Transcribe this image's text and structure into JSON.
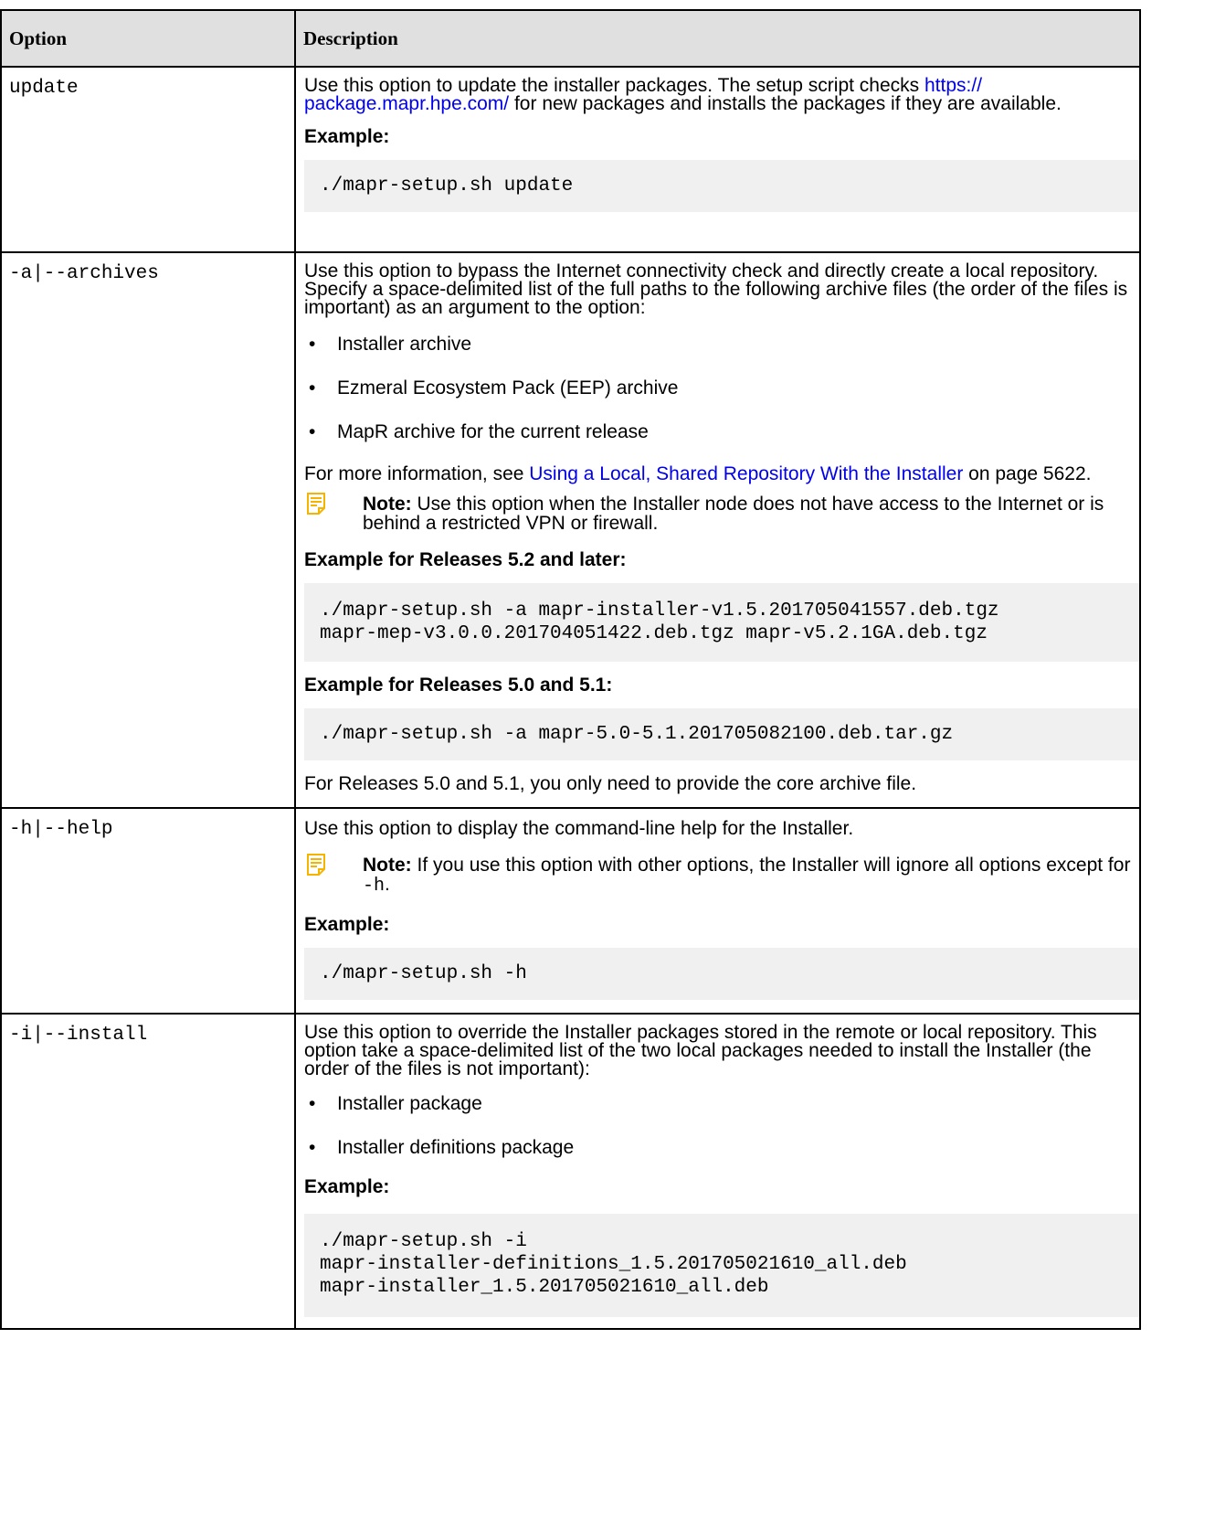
{
  "table": {
    "header": {
      "option": "Option",
      "description": "Description"
    },
    "rows": [
      {
        "option": "update",
        "desc_p1_a": "Use this option to update the installer packages. The setup script checks ",
        "desc_p1_link": "https://\npackage.mapr.hpe.com/",
        "desc_p1_b": " for new packages and installs the packages if they are available.",
        "example_label": "Example:",
        "code": "./mapr-setup.sh update"
      },
      {
        "option": "-a|--archives",
        "desc_p1": "Use this option to bypass the Internet connectivity check and directly create a local repository. Specify a space-delimited list of the full paths to the following archive files (the order of the files is important) as an argument to the option:",
        "bullets": [
          "Installer archive",
          "Ezmeral Ecosystem Pack (EEP) archive",
          "MapR archive for the current release"
        ],
        "more_a": "For more information, see ",
        "more_link": "Using a Local, Shared Repository With the Installer",
        "more_b": " on page 5622.",
        "note_label": "Note:",
        "note_text": " Use this option when the Installer node does not have access to the Internet or is behind a restricted VPN or firewall.",
        "example1_label": "Example for Releases 5.2 and later:",
        "code1": "./mapr-setup.sh -a mapr-installer-v1.5.201705041557.deb.tgz\nmapr-mep-v3.0.0.201704051422.deb.tgz mapr-v5.2.1GA.deb.tgz",
        "example2_label": "Example for Releases 5.0 and 5.1:",
        "code2": "./mapr-setup.sh -a mapr-5.0-5.1.201705082100.deb.tar.gz",
        "footer": "For Releases 5.0 and 5.1, you only need to provide the core archive file."
      },
      {
        "option": "-h|--help",
        "desc_p1": "Use this option to display the command-line help for the Installer.",
        "note_label": "Note:",
        "note_text_a": " If you use this option with other options, the Installer will ignore all options except for ",
        "note_code": "-h",
        "note_text_b": ".",
        "example_label": "Example:",
        "code": "./mapr-setup.sh -h"
      },
      {
        "option": "-i|--install",
        "desc_p1": "Use this option to override the Installer packages stored in the remote or local repository. This option take a space-delimited list of the two local packages needed to install the Installer (the order of the files is not important):",
        "bullets": [
          "Installer package",
          "Installer definitions package"
        ],
        "example_label": "Example:",
        "code": "./mapr-setup.sh -i\nmapr-installer-definitions_1.5.201705021610_all.deb\nmapr-installer_1.5.201705021610_all.deb"
      }
    ]
  },
  "colors": {
    "link": "#0000ee",
    "code_bg": "#f0f0f0",
    "header_bg": "#e0e0e0",
    "note_icon": "#f5b400"
  },
  "icons": {
    "note": "note-icon"
  }
}
